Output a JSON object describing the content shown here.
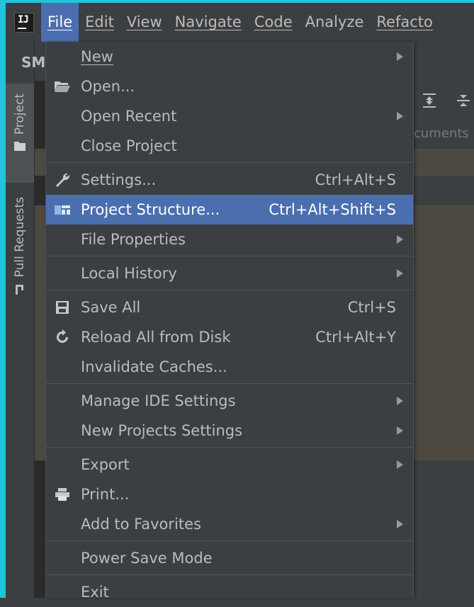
{
  "menubar": {
    "items": [
      {
        "label": "File"
      },
      {
        "label": "Edit"
      },
      {
        "label": "View"
      },
      {
        "label": "Navigate"
      },
      {
        "label": "Code"
      },
      {
        "label": "Analyze"
      },
      {
        "label": "Refacto"
      }
    ]
  },
  "tool_strip": {
    "project_title": "SM",
    "tabs": [
      {
        "label": "Project"
      },
      {
        "label": "Pull Requests"
      }
    ]
  },
  "background": {
    "documents_text": "cuments"
  },
  "file_menu": {
    "items": [
      {
        "label": "New",
        "shortcut": "",
        "submenu": true,
        "icon": "none"
      },
      {
        "label": "Open...",
        "shortcut": "",
        "submenu": false,
        "icon": "folder-icon"
      },
      {
        "label": "Open Recent",
        "shortcut": "",
        "submenu": true,
        "icon": "none"
      },
      {
        "label": "Close Project",
        "shortcut": "",
        "submenu": false,
        "icon": "none"
      },
      {
        "label": "Settings...",
        "shortcut": "Ctrl+Alt+S",
        "submenu": false,
        "icon": "wrench-icon"
      },
      {
        "label": "Project Structure...",
        "shortcut": "Ctrl+Alt+Shift+S",
        "submenu": false,
        "icon": "project-structure-icon",
        "selected": true
      },
      {
        "label": "File Properties",
        "shortcut": "",
        "submenu": true,
        "icon": "none"
      },
      {
        "label": "Local History",
        "shortcut": "",
        "submenu": true,
        "icon": "none"
      },
      {
        "label": "Save All",
        "shortcut": "Ctrl+S",
        "submenu": false,
        "icon": "save-icon"
      },
      {
        "label": "Reload All from Disk",
        "shortcut": "Ctrl+Alt+Y",
        "submenu": false,
        "icon": "reload-icon"
      },
      {
        "label": "Invalidate Caches...",
        "shortcut": "",
        "submenu": false,
        "icon": "none"
      },
      {
        "label": "Manage IDE Settings",
        "shortcut": "",
        "submenu": true,
        "icon": "none"
      },
      {
        "label": "New Projects Settings",
        "shortcut": "",
        "submenu": true,
        "icon": "none"
      },
      {
        "label": "Export",
        "shortcut": "",
        "submenu": true,
        "icon": "none"
      },
      {
        "label": "Print...",
        "shortcut": "",
        "submenu": false,
        "icon": "print-icon"
      },
      {
        "label": "Add to Favorites",
        "shortcut": "",
        "submenu": true,
        "icon": "none"
      },
      {
        "label": "Power Save Mode",
        "shortcut": "",
        "submenu": false,
        "icon": "none"
      },
      {
        "label": "Exit",
        "shortcut": "",
        "submenu": false,
        "icon": "none"
      }
    ]
  },
  "colors": {
    "accent": "#4b6eaf",
    "frame": "#22c4dd",
    "menu_bg": "#3c3f41",
    "text": "#bbbbbb"
  }
}
